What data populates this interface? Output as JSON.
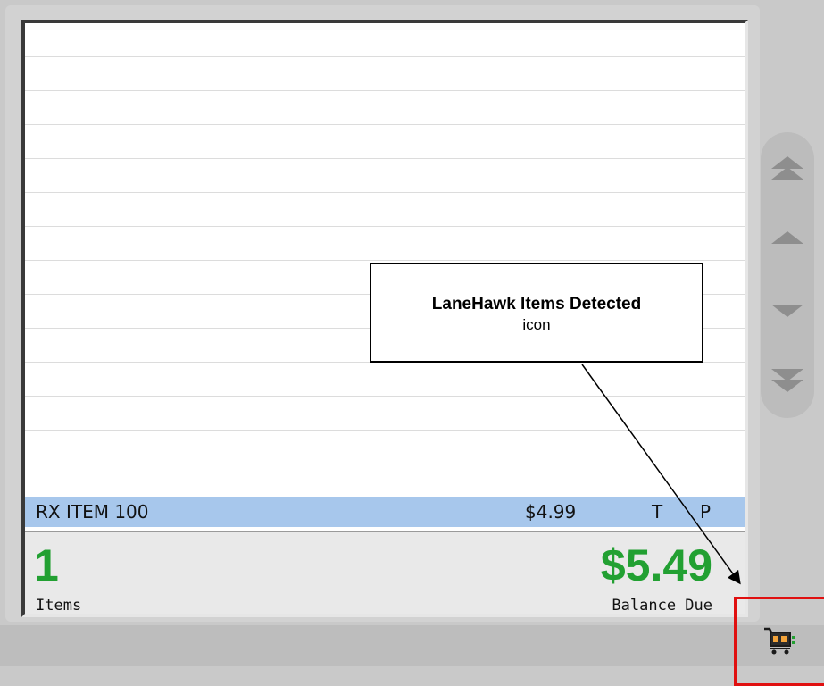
{
  "receipt": {
    "items": [
      {
        "description": "RX ITEM 100",
        "price": "$4.99",
        "flags": [
          "T",
          "P"
        ]
      }
    ]
  },
  "totals": {
    "items_count": "1",
    "items_label": "Items",
    "balance": "$5.49",
    "balance_label": "Balance Due"
  },
  "annotation": {
    "title": "LaneHawk Items Detected",
    "subtitle": "icon"
  },
  "scroll_controls": [
    "page-up-icon",
    "line-up-icon",
    "line-down-icon",
    "page-down-icon"
  ],
  "colors": {
    "accent_green": "#22a032",
    "row_highlight": "#a7c7ec",
    "highlight_red": "#e01010"
  }
}
